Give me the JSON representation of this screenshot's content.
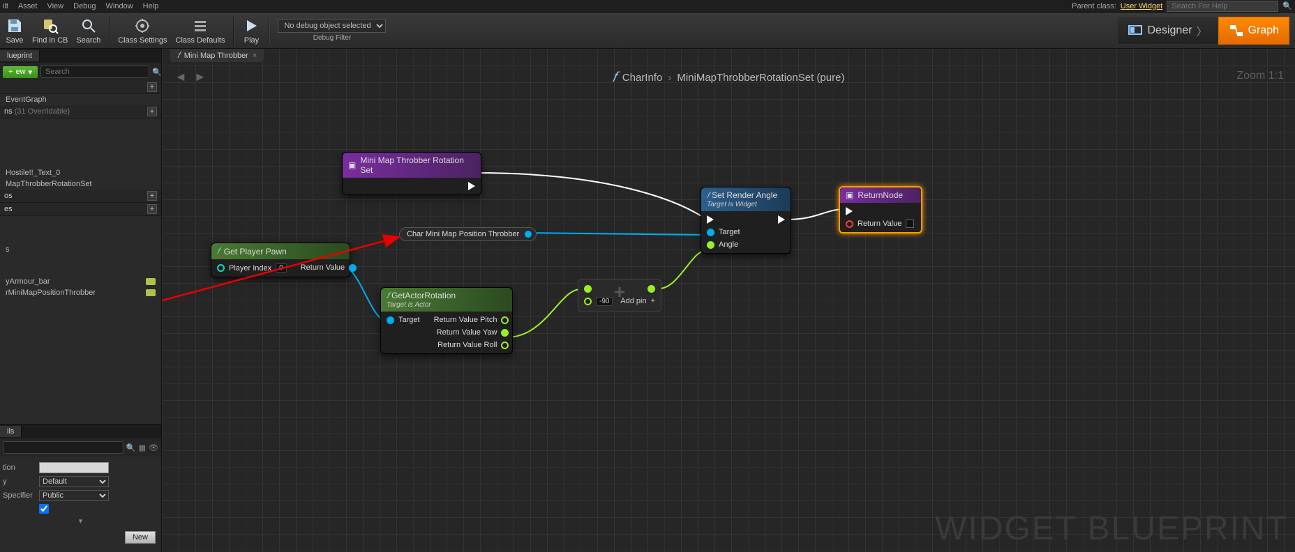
{
  "menubar": {
    "items": [
      "ilt",
      "Asset",
      "View",
      "Debug",
      "Window",
      "Help"
    ],
    "parent_label": "Parent class:",
    "parent_link": "User Widget"
  },
  "helpsearch": {
    "placeholder": "Search For Help"
  },
  "toolbar": {
    "save": "Save",
    "find": "Find in CB",
    "search": "Search",
    "class_settings": "Class Settings",
    "class_defaults": "Class Defaults",
    "play": "Play",
    "debug_select": "No debug object selected",
    "debug_filter": "Debug Filter",
    "designer": "Designer",
    "graph": "Graph"
  },
  "left": {
    "tab": "lueprint",
    "addnew": "ew",
    "search_placeholder": "Search",
    "cats": {
      "graphs": "EventGraph",
      "functions": "ns",
      "functions_over": "(31 Overridable)",
      "macros": "os",
      "vars": "s",
      "evtdisp": "es"
    },
    "fnitems": [
      "Hostile!!_Text_0",
      "MapThrobberRotationSet"
    ],
    "varsitems": [
      "yArmour_bar",
      "rMiniMapPositionThrobber"
    ],
    "details_tab": "ils",
    "details": {
      "desc_label": "tion",
      "desc_value": "",
      "category_label": "y",
      "category_value": "Default",
      "access_label": "Specifier",
      "access_value": "Public",
      "new": "New"
    }
  },
  "graph": {
    "tab": "Mini Map Throbber",
    "crumb1": "CharInfo",
    "crumb2": "MiniMapThrobberRotationSet (pure)",
    "zoom": "Zoom 1:1",
    "watermark": "WIDGET BLUEPRINT"
  },
  "nodes": {
    "entry": {
      "title": "Mini Map Throbber Rotation Set"
    },
    "getpawn": {
      "title": "Get Player Pawn",
      "in": "Player Index",
      "inval": "0",
      "out": "Return Value"
    },
    "varpill": {
      "label": "Char Mini Map Position Throbber"
    },
    "getrot": {
      "title": "GetActorRotation",
      "sub": "Target is Actor",
      "in": "Target",
      "out_pitch": "Return Value Pitch",
      "out_yaw": "Return Value Yaw",
      "out_roll": "Return Value Roll"
    },
    "math": {
      "val": "-90",
      "addpin": "Add pin"
    },
    "setangle": {
      "title": "Set Render Angle",
      "sub": "Target is Widget",
      "target": "Target",
      "angle": "Angle"
    },
    "return": {
      "title": "ReturnNode",
      "out": "Return Value"
    }
  }
}
